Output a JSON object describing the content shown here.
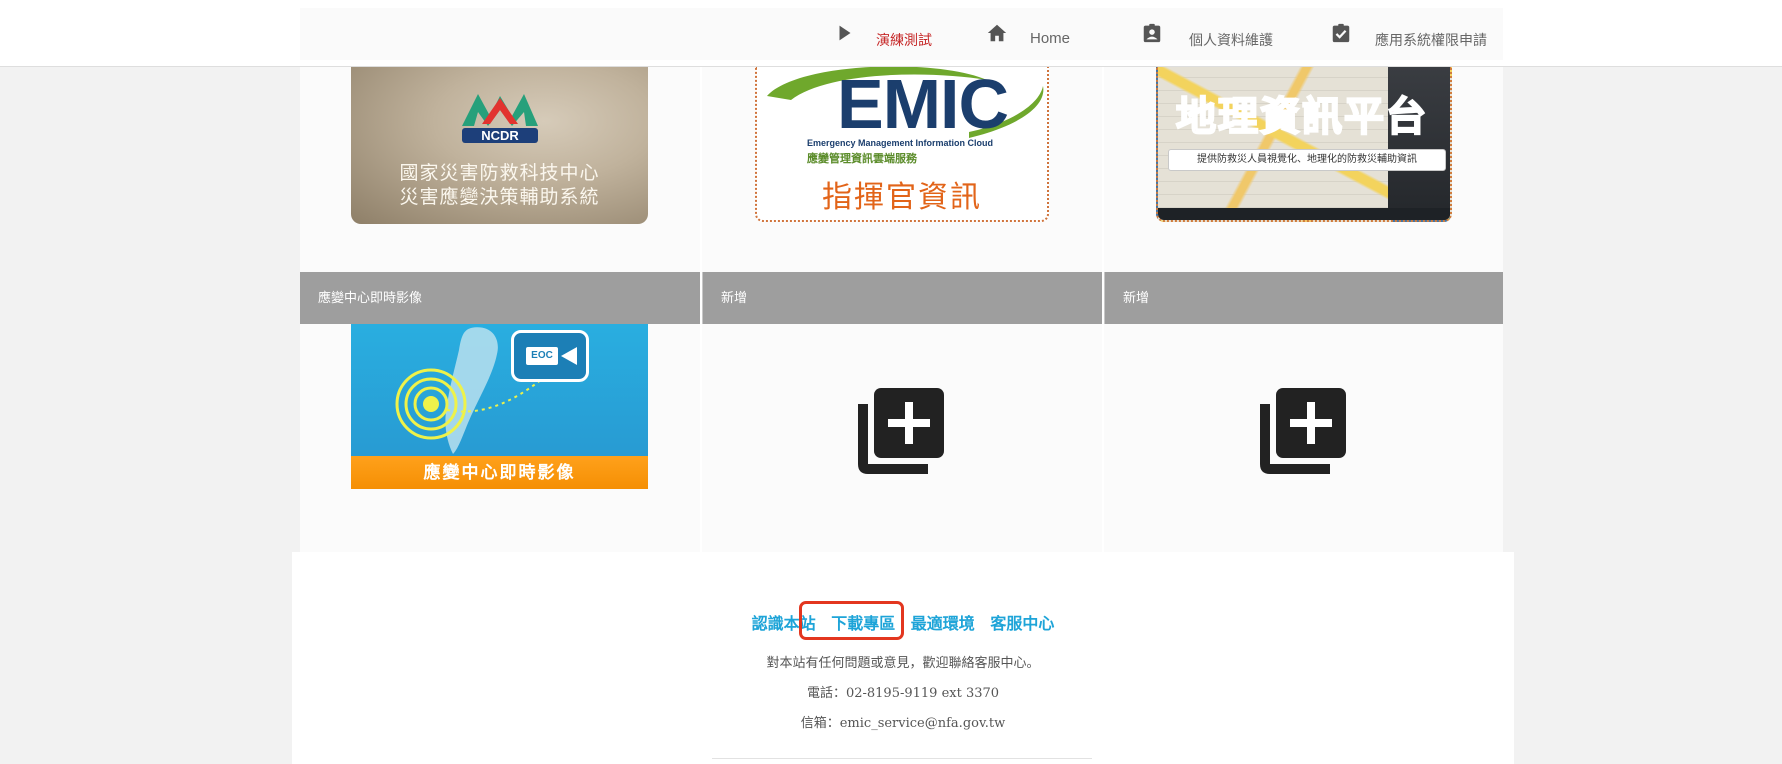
{
  "nav": {
    "items": [
      {
        "label": "演練測試",
        "icon": "play-icon",
        "active": true
      },
      {
        "label": "Home",
        "icon": "home-icon"
      },
      {
        "label": "個人資料維護",
        "icon": "profile-badge-icon"
      },
      {
        "label": "應用系統權限申請",
        "icon": "checklist-icon"
      }
    ]
  },
  "cards": {
    "ncdr": {
      "logo_text": "NCDR",
      "line1": "國家災害防救科技中心",
      "line2": "災害應變決策輔助系統"
    },
    "emic": {
      "title": "EMIC",
      "subtitle_en": "Emergency Management Information Cloud",
      "subtitle_zh": "應變管理資訊雲端服務",
      "caption": "指揮官資訊"
    },
    "gis": {
      "title": "地理資訊平台",
      "banner": "提供防救災人員視覺化、地理化的防救災輔助資訊"
    },
    "eoc": {
      "header": "應變中心即時影像",
      "camera_label": "EOC",
      "caption": "應變中心即時影像"
    },
    "add1": {
      "header": "新增",
      "icon": "add-box-icon"
    },
    "add2": {
      "header": "新增",
      "icon": "add-box-icon"
    }
  },
  "footer": {
    "links": [
      "認識本站",
      "下載專區",
      "最適環境",
      "客服中心"
    ],
    "highlighted_link": "下載專區",
    "line1": "對本站有任何問題或意見，歡迎聯絡客服中心。",
    "line2": "電話：02-8195-9119 ext 3370",
    "line3": "信箱：emic_service@nfa.gov.tw"
  },
  "colors": {
    "accent_link": "#1ea4d8",
    "active_nav": "#c62828",
    "header_gray": "#9e9e9e",
    "highlight_box": "#e3361f"
  }
}
